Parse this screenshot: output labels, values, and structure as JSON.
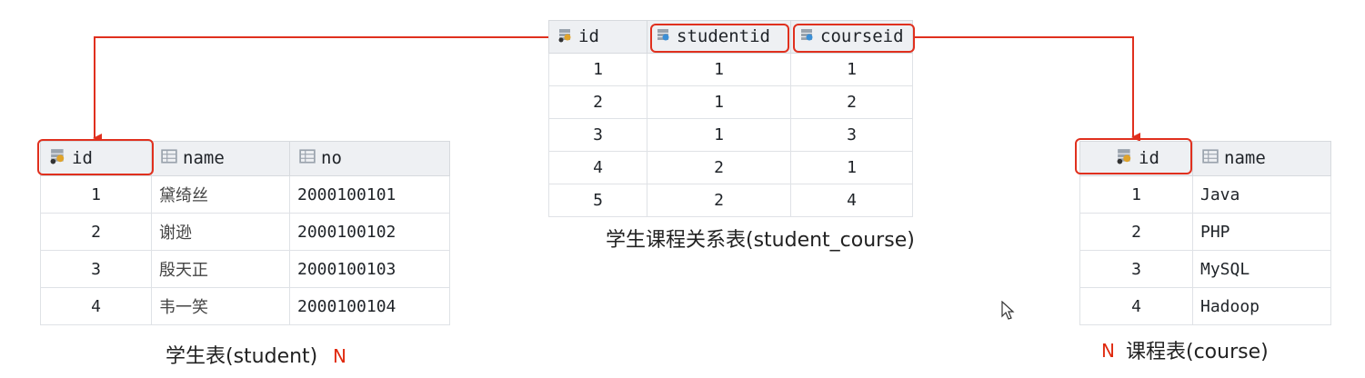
{
  "student": {
    "columns": [
      "id",
      "name",
      "no"
    ],
    "rows": [
      [
        "1",
        "黛绮丝",
        "2000100101"
      ],
      [
        "2",
        "谢逊",
        "2000100102"
      ],
      [
        "3",
        "殷天正",
        "2000100103"
      ],
      [
        "4",
        "韦一笑",
        "2000100104"
      ]
    ],
    "caption": "学生表(student)",
    "cardinality": "N"
  },
  "student_course": {
    "columns": [
      "id",
      "studentid",
      "courseid"
    ],
    "rows": [
      [
        "1",
        "1",
        "1"
      ],
      [
        "2",
        "1",
        "2"
      ],
      [
        "3",
        "1",
        "3"
      ],
      [
        "4",
        "2",
        "1"
      ],
      [
        "5",
        "2",
        "4"
      ]
    ],
    "caption": "学生课程关系表(student_course)"
  },
  "course": {
    "columns": [
      "id",
      "name"
    ],
    "rows": [
      [
        "1",
        "Java"
      ],
      [
        "2",
        "PHP"
      ],
      [
        "3",
        "MySQL"
      ],
      [
        "4",
        "Hadoop"
      ]
    ],
    "caption": "课程表(course)",
    "cardinality": "N"
  },
  "colors": {
    "highlight": "#e0301e",
    "key_icon": "#e0a32a",
    "fk_icon": "#3b8fd6",
    "col_icon": "#9aa3ad"
  }
}
